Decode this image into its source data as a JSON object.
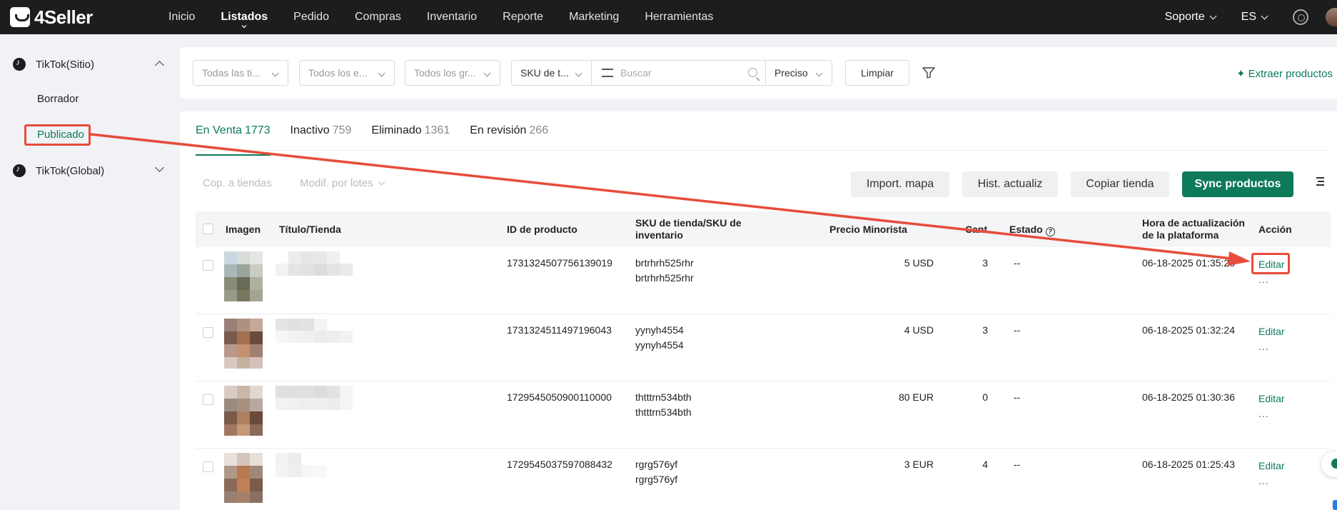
{
  "brand": {
    "name": "4Seller"
  },
  "topnav": {
    "items": [
      {
        "label": "Inicio"
      },
      {
        "label": "Listados"
      },
      {
        "label": "Pedido"
      },
      {
        "label": "Compras"
      },
      {
        "label": "Inventario"
      },
      {
        "label": "Reporte"
      },
      {
        "label": "Marketing"
      },
      {
        "label": "Herramientas"
      }
    ],
    "active": "Listados",
    "support": "Soporte",
    "language": "ES"
  },
  "sidebar": {
    "groups": [
      {
        "label": "TikTok(Sitio)",
        "expanded": true,
        "items": [
          {
            "label": "Borrador"
          },
          {
            "label": "Publicado",
            "active": true
          }
        ]
      },
      {
        "label": "TikTok(Global)",
        "expanded": false,
        "items": []
      }
    ]
  },
  "filters": {
    "shop": "Todas las ti...",
    "status": "Todos los e...",
    "group": "Todos los gr...",
    "search_type": "SKU de t...",
    "search_placeholder": "Buscar",
    "match": "Preciso",
    "clear_label": "Limpiar",
    "extract_label": "Extraer productos"
  },
  "tabs": [
    {
      "label": "En Venta",
      "count": "1773",
      "active": true
    },
    {
      "label": "Inactivo",
      "count": "759"
    },
    {
      "label": "Eliminado",
      "count": "1361"
    },
    {
      "label": "En revisión",
      "count": "266"
    }
  ],
  "toolbar": {
    "copy_to_shops": "Cop. a tiendas",
    "bulk_edit": "Modif. por lotes",
    "import_map": "Import. mapa",
    "update_history": "Hist. actualiz",
    "copy_shop": "Copiar tienda",
    "sync": "Sync productos"
  },
  "table": {
    "columns": {
      "image": "Imagen",
      "title": "Título/Tienda",
      "product_id": "ID de producto",
      "sku_1": "SKU de tienda/SKU de",
      "sku_2": "inventario",
      "price": "Precio Minorista",
      "qty": "Cant.",
      "status": "Estado",
      "update_1": "Hora de actualización",
      "update_2": "de la plataforma",
      "action": "Acción"
    },
    "rows": [
      {
        "product_id": "1731324507756139019",
        "shop_sku": "brtrhrh525rhr",
        "inv_sku": "brtrhrh525rhr",
        "price": "5 USD",
        "qty": "3",
        "status": "--",
        "updated": "06-18-2025 01:35:28",
        "edit": "Editar",
        "more": "..."
      },
      {
        "product_id": "1731324511497196043",
        "shop_sku": "yynyh4554",
        "inv_sku": "yynyh4554",
        "price": "4 USD",
        "qty": "3",
        "status": "--",
        "updated": "06-18-2025 01:32:24",
        "edit": "Editar",
        "more": "..."
      },
      {
        "product_id": "1729545050900110000",
        "shop_sku": "thtttrn534bth",
        "inv_sku": "thtttrn534bth",
        "price": "80 EUR",
        "qty": "0",
        "status": "--",
        "updated": "06-18-2025 01:30:36",
        "edit": "Editar",
        "more": "..."
      },
      {
        "product_id": "1729545037597088432",
        "shop_sku": "rgrg576yf",
        "inv_sku": "rgrg576yf",
        "price": "3 EUR",
        "qty": "4",
        "status": "--",
        "updated": "06-18-2025 01:25:43",
        "edit": "Editar",
        "more": "..."
      }
    ]
  },
  "colors": {
    "accent": "#0d7a5f",
    "primary_button": "#0f7a5a",
    "annotation": "#e74c3c",
    "topbar": "#1b1d1f"
  }
}
